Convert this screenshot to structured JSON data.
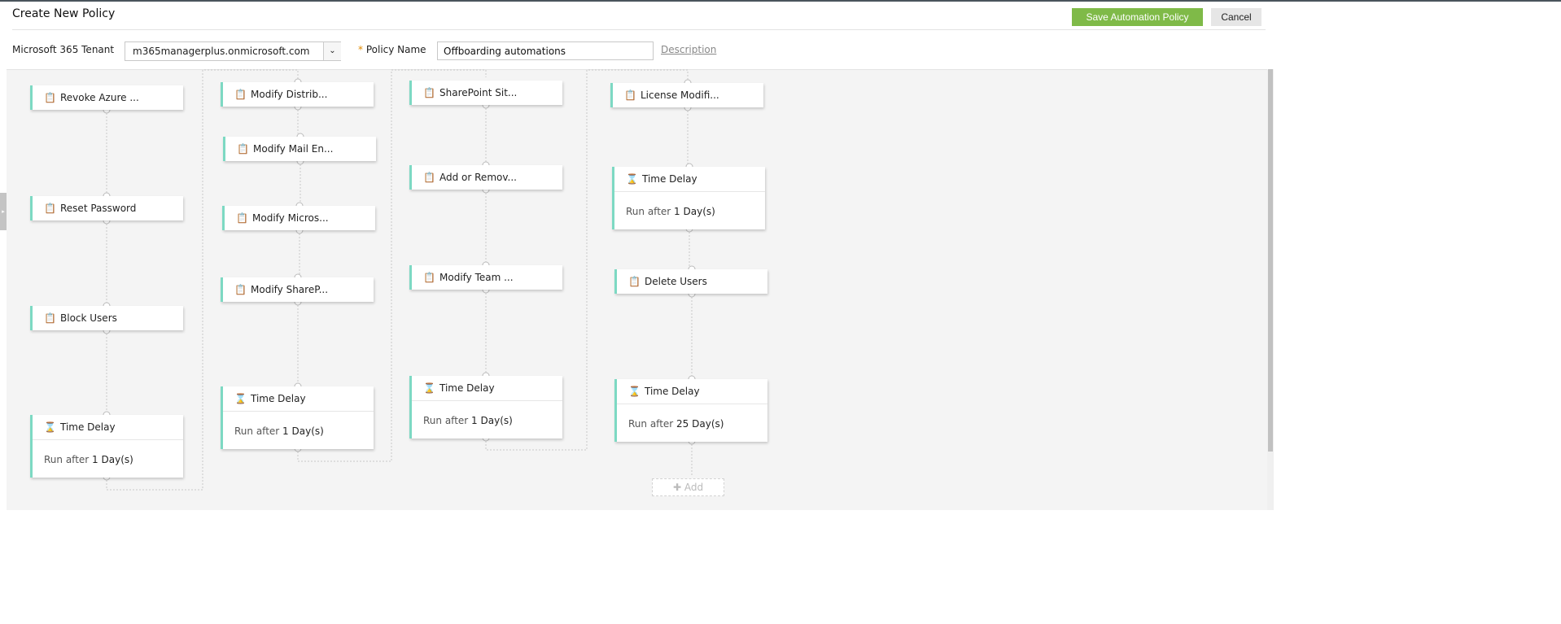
{
  "header": {
    "title": "Create New Policy",
    "save_label": "Save Automation Policy",
    "cancel_label": "Cancel"
  },
  "form": {
    "tenant_label": "Microsoft 365 Tenant",
    "tenant_value": "m365managerplus.onmicrosoft.com",
    "required_mark": "*",
    "policy_name_label": "Policy Name",
    "policy_name_value": "Offboarding automations",
    "description_link": "Description"
  },
  "nodes": {
    "c1": [
      "Revoke Azure ...",
      "Reset Password",
      "Block Users"
    ],
    "c2": [
      "Modify Distrib...",
      "Modify Mail En...",
      "Modify Micros...",
      "Modify ShareP..."
    ],
    "c3": [
      "SharePoint Sit...",
      "Add or Remov...",
      "Modify Team ..."
    ],
    "c4": [
      "License Modifi...",
      "Delete Users"
    ]
  },
  "delay": {
    "title": "Time Delay",
    "run_after": "Run after",
    "unit": "Day(s)",
    "values": [
      "1",
      "1",
      "1",
      "1",
      "25"
    ]
  },
  "add_label": "Add",
  "colors": {
    "accent": "#7dd9c3",
    "save": "#7fba48"
  }
}
